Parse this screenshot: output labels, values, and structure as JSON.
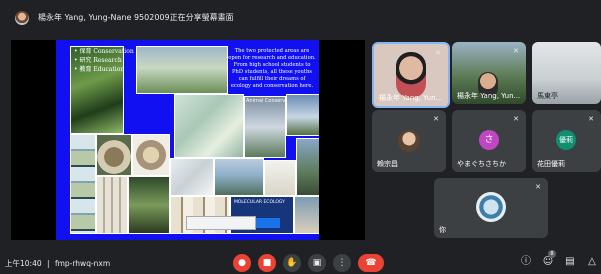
{
  "presenter": {
    "text": "楊永年 Yang, Yung-Nane 9502009正在分享螢幕畫面"
  },
  "slide": {
    "bullets": [
      "• 保育 Conservation",
      "• 研究 Research",
      "• 教育 Education"
    ],
    "paragraph": "The two protected areas are open for research and education. From high school students to PhD students, all these youths can fulfill their dreams of ecology and conservation here.",
    "animal_label": "Animal Conservation",
    "molecular_label": "MOLECULAR ECOLOGY"
  },
  "participants": [
    {
      "name": "楊永年 Yang, Yun...",
      "mic": "muted"
    },
    {
      "name": "楊永年 Yang, Yun...",
      "mic": "muted"
    },
    {
      "name": "馬東亭",
      "mic": ""
    },
    {
      "name": "賴宗昌",
      "mic": "muted"
    },
    {
      "name": "やまぐちさちか",
      "avatar_letter": "さ",
      "color": "#c046c4",
      "mic": "muted"
    },
    {
      "name": "花田優莉",
      "avatar_letter": "優莉",
      "color": "#0f8f6f",
      "mic": "muted"
    },
    {
      "name": "你",
      "mic": "muted"
    }
  ],
  "bottom": {
    "time": "上午10:40",
    "separator": "|",
    "meeting_code": "fmp-rhwq-nxm"
  },
  "icons": {
    "mic": "mic-off-icon",
    "camera": "camera-off-icon",
    "hand": "raise-hand-icon",
    "present": "present-icon",
    "more": "more-options-icon",
    "hangup": "hang-up-icon",
    "info": "info-icon",
    "people": "people-icon",
    "chat": "chat-icon",
    "activities": "activities-icon"
  },
  "badges": {
    "people_count": "8"
  },
  "colors": {
    "hangup": "#ea4335",
    "background": "#202124",
    "tile": "#3c4043",
    "slide_blue": "#1010f0"
  }
}
